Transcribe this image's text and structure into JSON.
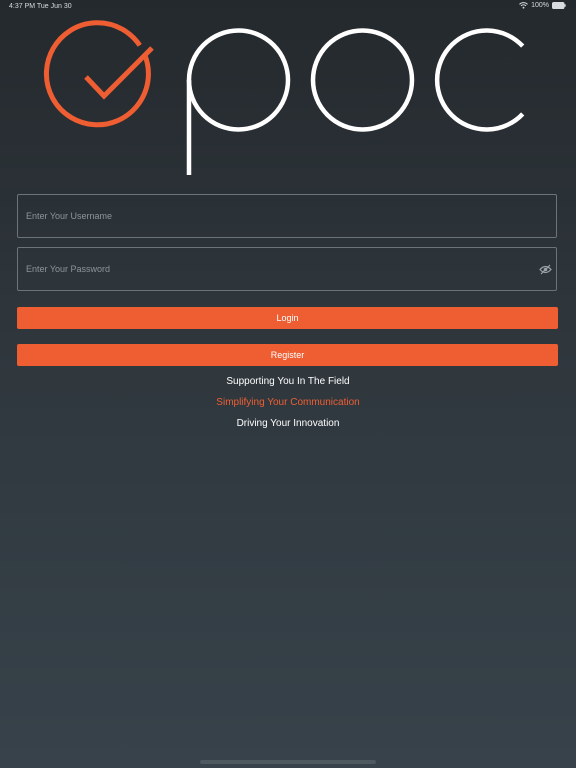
{
  "status_bar": {
    "time": "4:37 PM  Tue Jun 30",
    "battery": "100%"
  },
  "login_form": {
    "username_placeholder": "Enter Your Username",
    "password_placeholder": "Enter Your Password",
    "login_label": "Login",
    "register_label": "Register"
  },
  "taglines": [
    "Supporting You In The Field",
    "Simplifying Your Communication",
    "Driving Your Innovation"
  ],
  "colors": {
    "accent": "#ee5e32",
    "background_top": "#24292d",
    "background_bottom": "#37424a"
  },
  "icons": {
    "logo_mark": "checkmark-circle-icon",
    "password_toggle": "eye-slash-icon",
    "wifi": "wifi-icon",
    "battery": "battery-icon"
  }
}
